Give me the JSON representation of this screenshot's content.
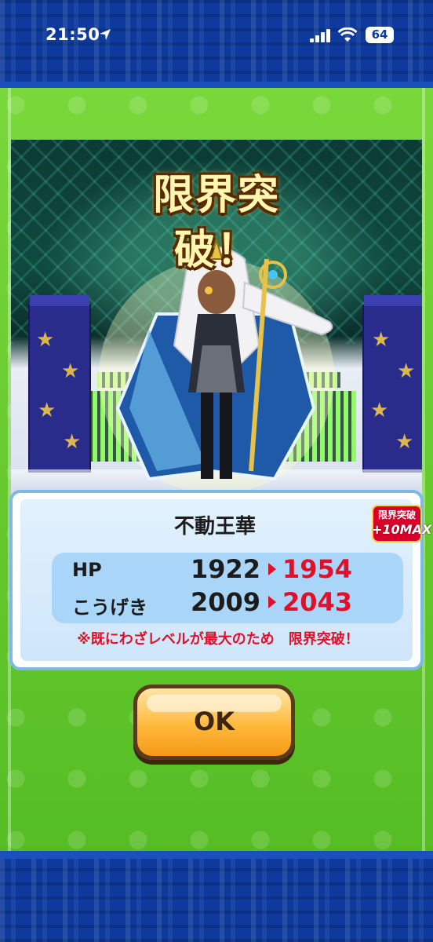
{
  "status_bar": {
    "time": "21:50",
    "battery": "64",
    "icons": [
      "location-arrow-icon",
      "signal-icon",
      "wifi-icon",
      "battery-icon"
    ]
  },
  "title": "限界突破！",
  "result": {
    "unit_name": "不動王華",
    "badge_top": "限界突破",
    "badge_bottom": "+10MAX",
    "stats": [
      {
        "label": "HP",
        "old": "1922",
        "new": "1954"
      },
      {
        "label": "こうげき",
        "old": "2009",
        "new": "2043"
      }
    ],
    "note": "※既にわざレベルが最大のため　限界突破！"
  },
  "ok_button": {
    "label": "OK"
  },
  "colors": {
    "frame_blue": "#0d3a9c",
    "field_green": "#5fc62b",
    "panel_border": "#7cb9e8",
    "stats_box": "#a9d6f8",
    "increase_red": "#e0102a",
    "button_orange": "#ffb93c"
  }
}
